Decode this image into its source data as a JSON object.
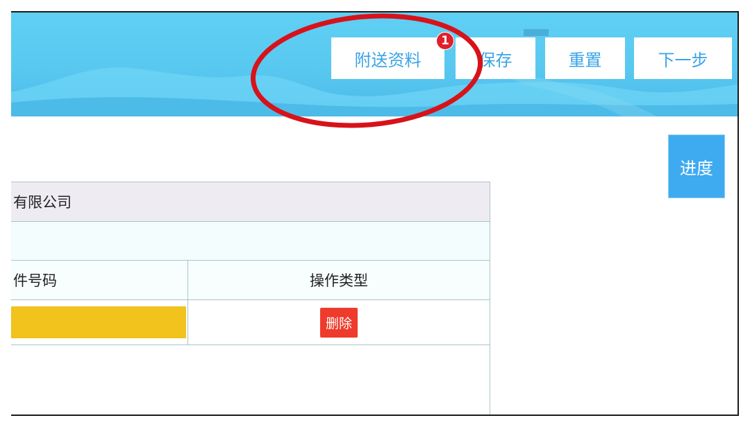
{
  "toolbar": {
    "attach_label": "附送资料",
    "save_label": "保存",
    "reset_label": "重置",
    "next_label": "下一步",
    "badge_number": "1"
  },
  "side": {
    "progress_label": "进度"
  },
  "table": {
    "company_name": "有限公司",
    "columns": [
      "件号码",
      "操作类型"
    ],
    "rows": [
      {
        "id_value": "",
        "action_label": "删除"
      }
    ]
  },
  "colors": {
    "banner": "#5fd0f4",
    "button_text": "#3aa3e6",
    "callout": "#d8121a",
    "field_highlight": "#f2c21d",
    "delete_button": "#ee3b2c"
  }
}
